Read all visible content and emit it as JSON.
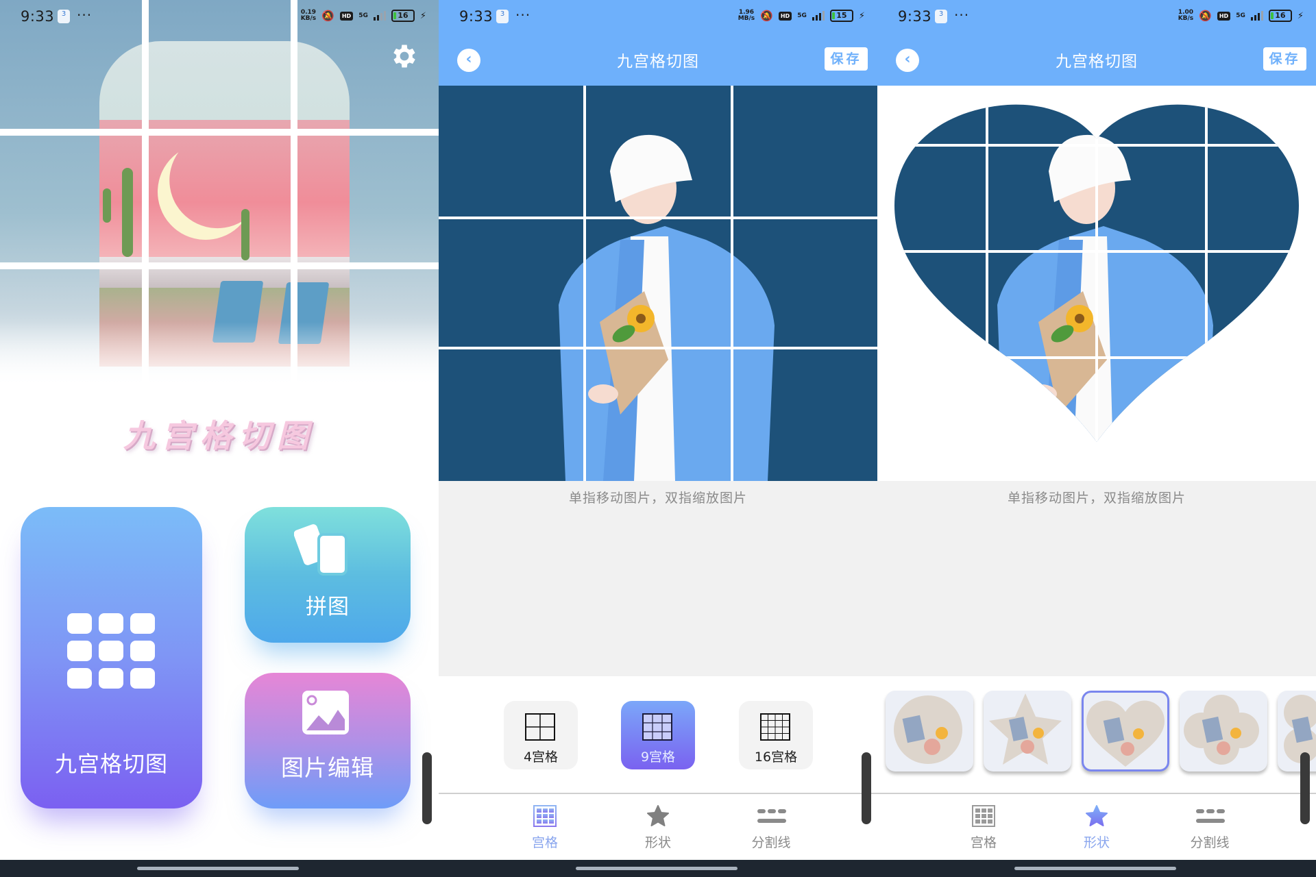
{
  "panels": [
    {
      "id": "home",
      "status": {
        "time": "9:33",
        "notif_count": "3",
        "speed_value": "0.19",
        "speed_unit": "KB/s",
        "network": "5G",
        "battery": "16"
      },
      "app_title": "九宫格切图",
      "settings_icon": "gear-icon",
      "cards": {
        "grid_cut": {
          "label": "九宫格切图",
          "icon": "nine-grid-icon"
        },
        "collage": {
          "label": "拼图",
          "icon": "cards-icon"
        },
        "photo_edit": {
          "label": "图片编辑",
          "icon": "image-icon"
        }
      }
    },
    {
      "id": "editor-grid",
      "status": {
        "time": "9:33",
        "notif_count": "3",
        "speed_value": "1.96",
        "speed_unit": "MB/s",
        "network": "5G",
        "battery": "15"
      },
      "header": {
        "title": "九宫格切图",
        "back_icon": "chevron-left-icon",
        "save_label": "保存"
      },
      "hint": "单指移动图片，双指缩放图片",
      "grid_options": [
        {
          "label": "4宫格",
          "rows": 2,
          "cols": 2,
          "selected": false
        },
        {
          "label": "9宫格",
          "rows": 3,
          "cols": 3,
          "selected": true
        },
        {
          "label": "16宫格",
          "rows": 4,
          "cols": 4,
          "selected": false
        }
      ],
      "nav": [
        {
          "label": "宫格",
          "icon": "grid-icon",
          "active": true
        },
        {
          "label": "形状",
          "icon": "star-icon",
          "active": false
        },
        {
          "label": "分割线",
          "icon": "divider-lines-icon",
          "active": false
        }
      ]
    },
    {
      "id": "editor-shape",
      "status": {
        "time": "9:33",
        "notif_count": "3",
        "speed_value": "1.00",
        "speed_unit": "KB/s",
        "network": "5G",
        "battery": "16"
      },
      "header": {
        "title": "九宫格切图",
        "back_icon": "chevron-left-icon",
        "save_label": "保存"
      },
      "hint": "单指移动图片，双指缩放图片",
      "shape_options": [
        {
          "shape": "circle",
          "selected": false
        },
        {
          "shape": "star",
          "selected": false
        },
        {
          "shape": "heart",
          "selected": true
        },
        {
          "shape": "flower",
          "selected": false
        },
        {
          "shape": "clover",
          "selected": false
        }
      ],
      "nav": [
        {
          "label": "宫格",
          "icon": "grid-icon",
          "active": false
        },
        {
          "label": "形状",
          "icon": "star-icon",
          "active": true
        },
        {
          "label": "分割线",
          "icon": "divider-lines-icon",
          "active": false
        }
      ]
    }
  ],
  "colors": {
    "header_blue": "#6eb0fb",
    "canvas_navy": "#1d5179",
    "accent_purple": "#7a62f0",
    "nav_active": "#8aa6ee"
  }
}
